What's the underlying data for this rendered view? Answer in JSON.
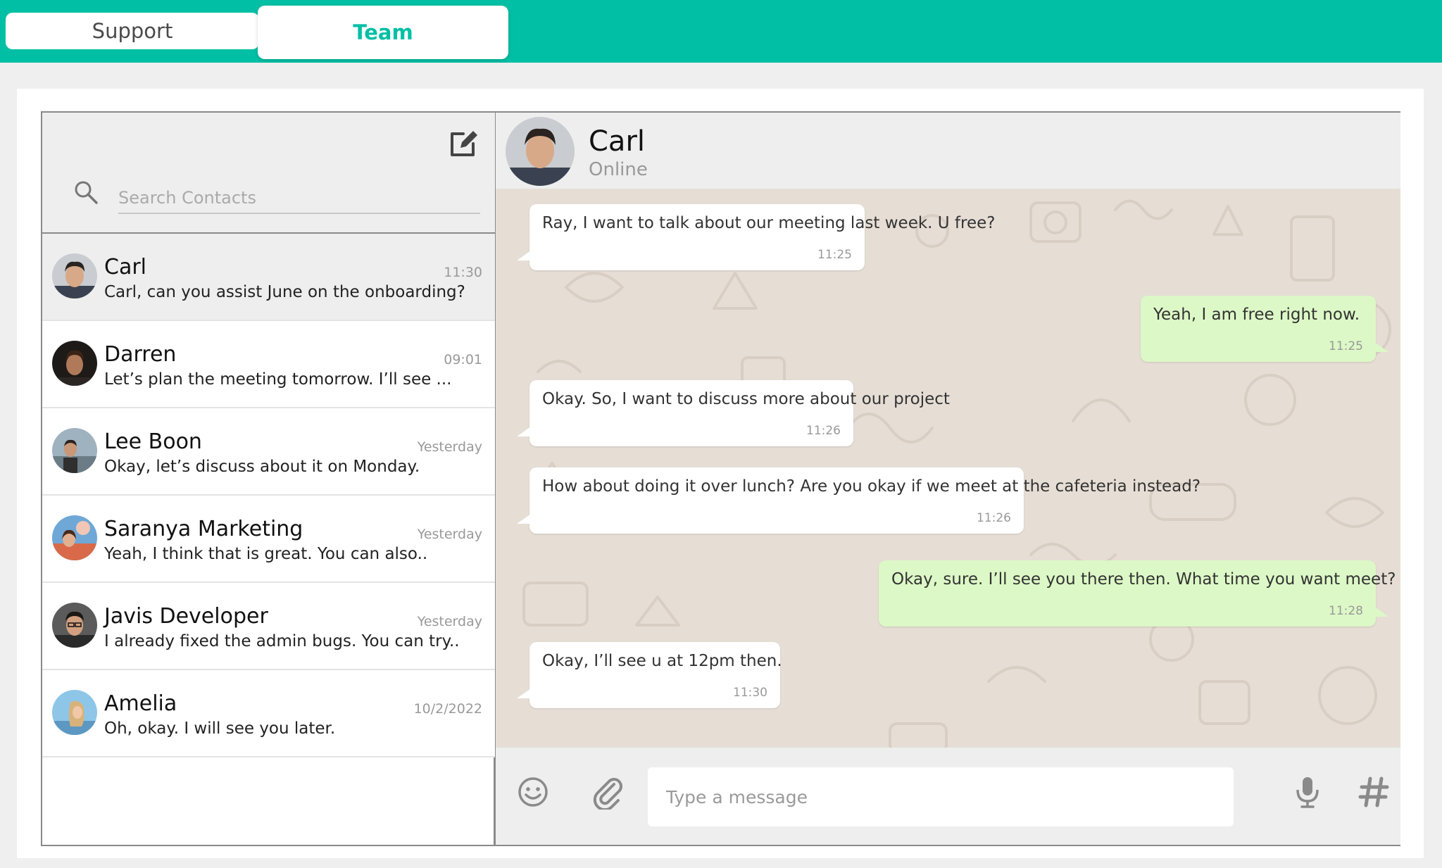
{
  "tabs": [
    {
      "label": "Support",
      "active": false
    },
    {
      "label": "Team",
      "active": true
    }
  ],
  "colors": {
    "accent": "#00bfa5",
    "outgoing_bubble": "#dcf8c6",
    "chat_background": "#e6ded5"
  },
  "sidebar": {
    "search": {
      "placeholder": "Search Contacts",
      "value": ""
    },
    "compose_icon": "compose-icon",
    "contacts": [
      {
        "name": "Carl",
        "preview": "Carl, can you assist June on the onboarding?",
        "time": "11:30",
        "active": true
      },
      {
        "name": "Darren",
        "preview": "Let’s plan the meeting tomorrow. I’ll see ...",
        "time": "09:01",
        "active": false
      },
      {
        "name": "Lee Boon",
        "preview": "Okay, let’s discuss about it on Monday.",
        "time": "Yesterday",
        "active": false
      },
      {
        "name": "Saranya Marketing",
        "preview": "Yeah, I think that is great. You can also..",
        "time": "Yesterday",
        "active": false
      },
      {
        "name": "Javis Developer",
        "preview": "I already fixed the admin bugs. You can try..",
        "time": "Yesterday",
        "active": false
      },
      {
        "name": "Amelia",
        "preview": "Oh, okay. I will see you later.",
        "time": "10/2/2022",
        "active": false
      }
    ]
  },
  "chat": {
    "name": "Carl",
    "status": "Online",
    "messages": [
      {
        "direction": "in",
        "text": "Ray, I want to talk about our meeting last week. U free?",
        "time": "11:25"
      },
      {
        "direction": "out",
        "text": "Yeah, I am free right now.",
        "time": "11:25"
      },
      {
        "direction": "in",
        "text": "Okay. So, I want to discuss more about our project",
        "time": "11:26"
      },
      {
        "direction": "in",
        "text": "How about doing it over lunch? Are you okay if we meet at the cafeteria instead?",
        "time": "11:26"
      },
      {
        "direction": "out",
        "text": "Okay, sure. I’ll see you there then. What time you want meet?",
        "time": "11:28"
      },
      {
        "direction": "in",
        "text": "Okay, I’ll see u at 12pm then.",
        "time": "11:30"
      }
    ],
    "composer": {
      "placeholder": "Type a message",
      "value": ""
    },
    "footer_icons": [
      "emoji-icon",
      "attachment-icon",
      "microphone-icon",
      "hashtag-icon"
    ]
  }
}
